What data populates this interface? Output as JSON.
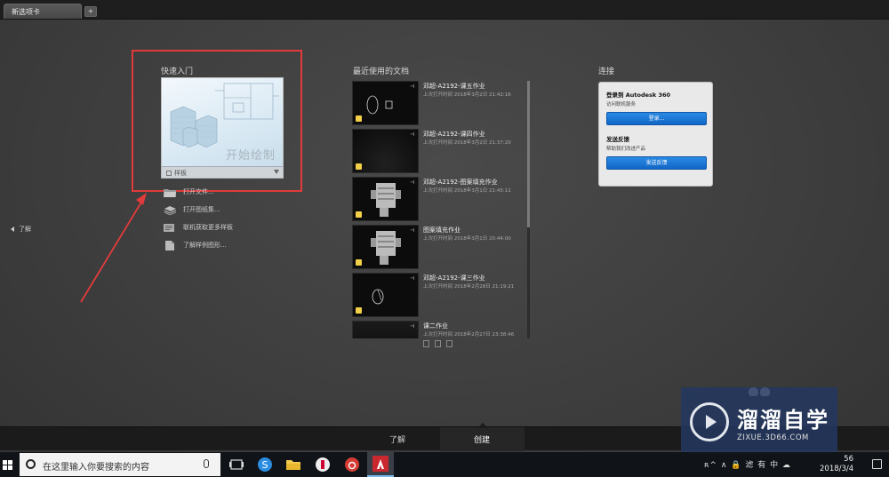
{
  "tabs": [
    {
      "label": "新选项卡"
    }
  ],
  "tab_add_label": "+",
  "left_panel": {
    "learn_label": "了解"
  },
  "quick_start": {
    "heading": "快速入门",
    "start_drawing": "开始绘制",
    "template_label": "样板",
    "links": [
      {
        "label": "打开文件...",
        "icon": "open-folder-icon"
      },
      {
        "label": "打开图纸集...",
        "icon": "sheet-set-icon"
      },
      {
        "label": "联机获取更多样板",
        "icon": "online-templates-icon"
      },
      {
        "label": "了解样例图形...",
        "icon": "sample-drawings-icon"
      }
    ]
  },
  "recent": {
    "heading": "最近使用的文档",
    "docs": [
      {
        "title": "邓超-A2192-课五作业",
        "meta": "上次打开时间 2018年3月2日 21:42:16"
      },
      {
        "title": "邓超-A2192-课四作业",
        "meta": "上次打开时间 2018年3月2日 21:37:20"
      },
      {
        "title": "邓超-A2192-图案填充作业",
        "meta": "上次打开时间 2018年3月1日 21:45:11"
      },
      {
        "title": "图案填充作业",
        "meta": "上次打开时间 2018年3月1日 20:44:00"
      },
      {
        "title": "邓超-A2192-课三作业",
        "meta": "上次打开时间 2018年2月28日 21:19:21"
      },
      {
        "title": "课二作业",
        "meta": "上次打开时间 2018年2月27日 23:38:46"
      }
    ]
  },
  "connect": {
    "heading": "连接",
    "signin_title": "登录到 Autodesk 360",
    "signin_sub": "访问联机服务",
    "signin_button": "登录...",
    "feedback_title": "发送反馈",
    "feedback_sub": "帮助我们改进产品",
    "feedback_button": "发送反馈"
  },
  "bottom_nav": {
    "learn": "了解",
    "create": "创建"
  },
  "watermark": {
    "title": "溜溜自学",
    "url": "ZIXUE.3D66.COM"
  },
  "taskbar": {
    "search_placeholder": "在这里输入你要搜索的内容",
    "tray_text": "ʀ^ ∧ 🔒 滤 有 中 ☁",
    "time": "56",
    "date": "2018/3/4"
  },
  "colors": {
    "accent_red": "#e23b3b",
    "button_blue": "#1a78d6",
    "badge_yellow": "#f2d049"
  }
}
